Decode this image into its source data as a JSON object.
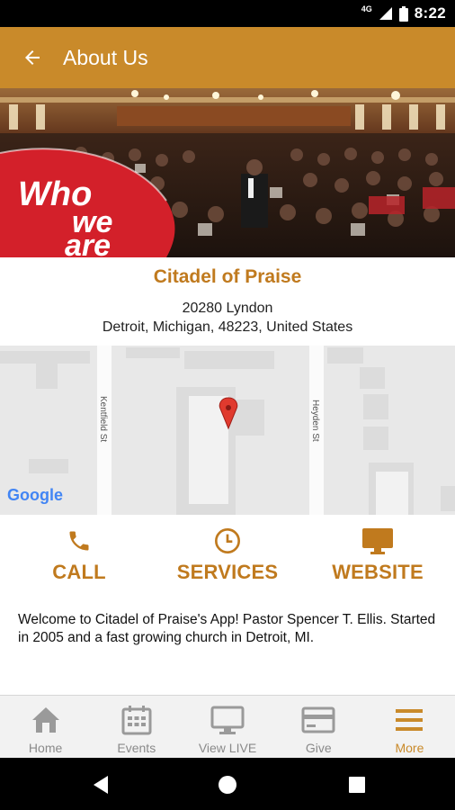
{
  "status_bar": {
    "network": "4G",
    "time": "8:22"
  },
  "app_bar": {
    "title": "About Us",
    "back_icon": "arrow-left-icon"
  },
  "hero": {
    "banner_lines": [
      "Who",
      "we",
      "are"
    ]
  },
  "church": {
    "name": "Citadel of Praise",
    "address_line1": "20280 Lyndon",
    "address_line2": "Detroit, Michigan, 48223, United States"
  },
  "map": {
    "streets": [
      "Kentfield St",
      "Heyden St"
    ],
    "logo": "Google"
  },
  "actions": [
    {
      "label": "CALL",
      "icon": "phone-icon"
    },
    {
      "label": "SERVICES",
      "icon": "clock-icon"
    },
    {
      "label": "WEBSITE",
      "icon": "monitor-icon"
    }
  ],
  "welcome_text": "Welcome to Citadel of Praise's App! Pastor Spencer T. Ellis. Started in 2005 and a fast growing church in Detroit, MI.",
  "tabs": [
    {
      "label": "Home",
      "icon": "home-icon",
      "active": false
    },
    {
      "label": "Events",
      "icon": "calendar-icon",
      "active": false
    },
    {
      "label": "View LIVE",
      "icon": "monitor-icon",
      "active": false
    },
    {
      "label": "Give",
      "icon": "credit-card-icon",
      "active": false
    },
    {
      "label": "More",
      "icon": "menu-icon",
      "active": true
    }
  ],
  "colors": {
    "accent": "#c98a2a",
    "accent_text": "#c07a1e",
    "banner_red": "#d3202a"
  }
}
